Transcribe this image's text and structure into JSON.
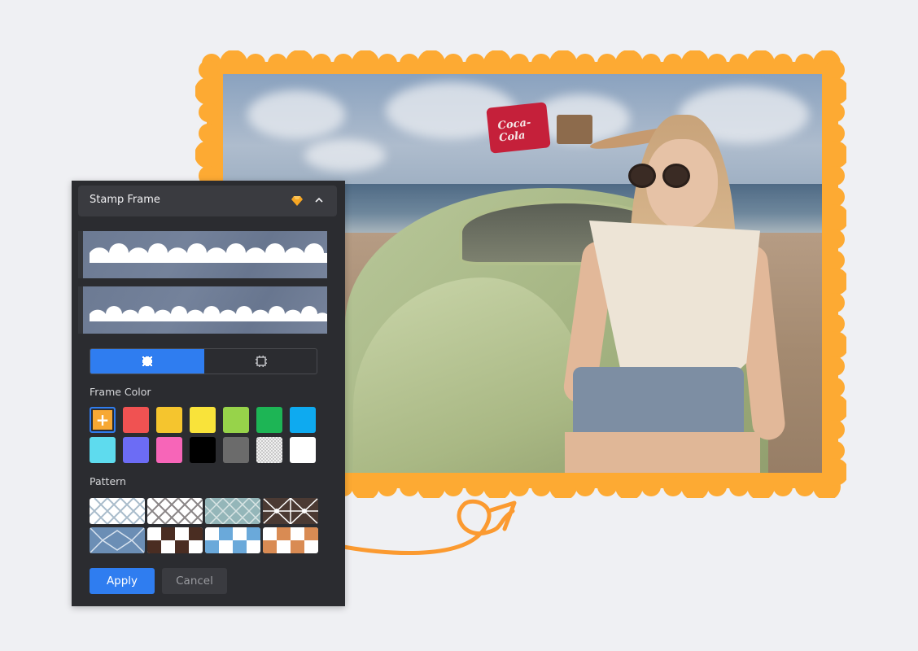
{
  "panel": {
    "title": "Stamp Frame",
    "icons": {
      "premium": "gem-icon",
      "collapse": "chevron-up-icon"
    },
    "frame_options": [
      {
        "name": "scallop-frame-style-1",
        "selected": false
      },
      {
        "name": "scallop-frame-style-2",
        "selected": false
      }
    ],
    "mode_toggle": {
      "options": [
        {
          "name": "fill-frame-mode",
          "icon": "stamp-filled-icon",
          "active": true
        },
        {
          "name": "outline-frame-mode",
          "icon": "stamp-outline-icon",
          "active": false
        }
      ]
    },
    "frame_color": {
      "label": "Frame Color",
      "add_symbol": "+",
      "selected": "#f7a833",
      "swatches": [
        "#f05252",
        "#f5c52e",
        "#f9e33a",
        "#97d34a",
        "#1db555",
        "#0eaaf0",
        "#5edbee",
        "#6c6cf5",
        "#f765b8",
        "#000000",
        "#6b6b6b",
        "transparent-gray",
        "#ffffff"
      ]
    },
    "pattern": {
      "label": "Pattern",
      "items": [
        {
          "name": "light-blue-lattice"
        },
        {
          "name": "gray-lattice"
        },
        {
          "name": "teal-lattice"
        },
        {
          "name": "brown-star-lattice"
        },
        {
          "name": "blue-ornament"
        },
        {
          "name": "brown-checker"
        },
        {
          "name": "blue-checker"
        },
        {
          "name": "orange-checker"
        }
      ]
    },
    "apply_label": "Apply",
    "cancel_label": "Cancel"
  },
  "preview": {
    "frame_color": "#fdaa33",
    "photo_description": "woman in sunglasses leaning on green vintage car at beach",
    "cooler_text": "Coca-Cola"
  },
  "colors": {
    "accent": "#2f7df0",
    "panel_bg": "#2b2c30",
    "arrow": "#fb9a30"
  }
}
